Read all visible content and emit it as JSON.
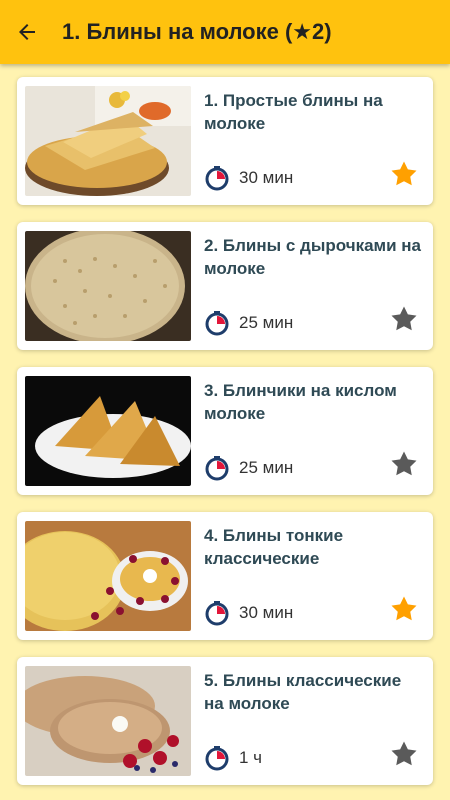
{
  "header": {
    "title": "1. Блины на молоке  (★2)"
  },
  "colors": {
    "appbar": "#FFC20E",
    "background": "#FFF3B0",
    "star_active": "#FFA000",
    "star_inactive": "#5A5A5A",
    "timer": "#1E3D6B",
    "timer_accent": "#E2173A"
  },
  "recipes": [
    {
      "title": "1. Простые блины на молоке",
      "time": "30 мин",
      "favorite": true
    },
    {
      "title": "2. Блины с дырочками на молоке",
      "time": "25 мин",
      "favorite": false
    },
    {
      "title": "3. Блинчики на кислом молоке",
      "time": "25 мин",
      "favorite": false
    },
    {
      "title": "4. Блины тонкие классические",
      "time": "30 мин",
      "favorite": true
    },
    {
      "title": "5. Блины классические на молоке",
      "time": "1 ч",
      "favorite": false
    }
  ]
}
